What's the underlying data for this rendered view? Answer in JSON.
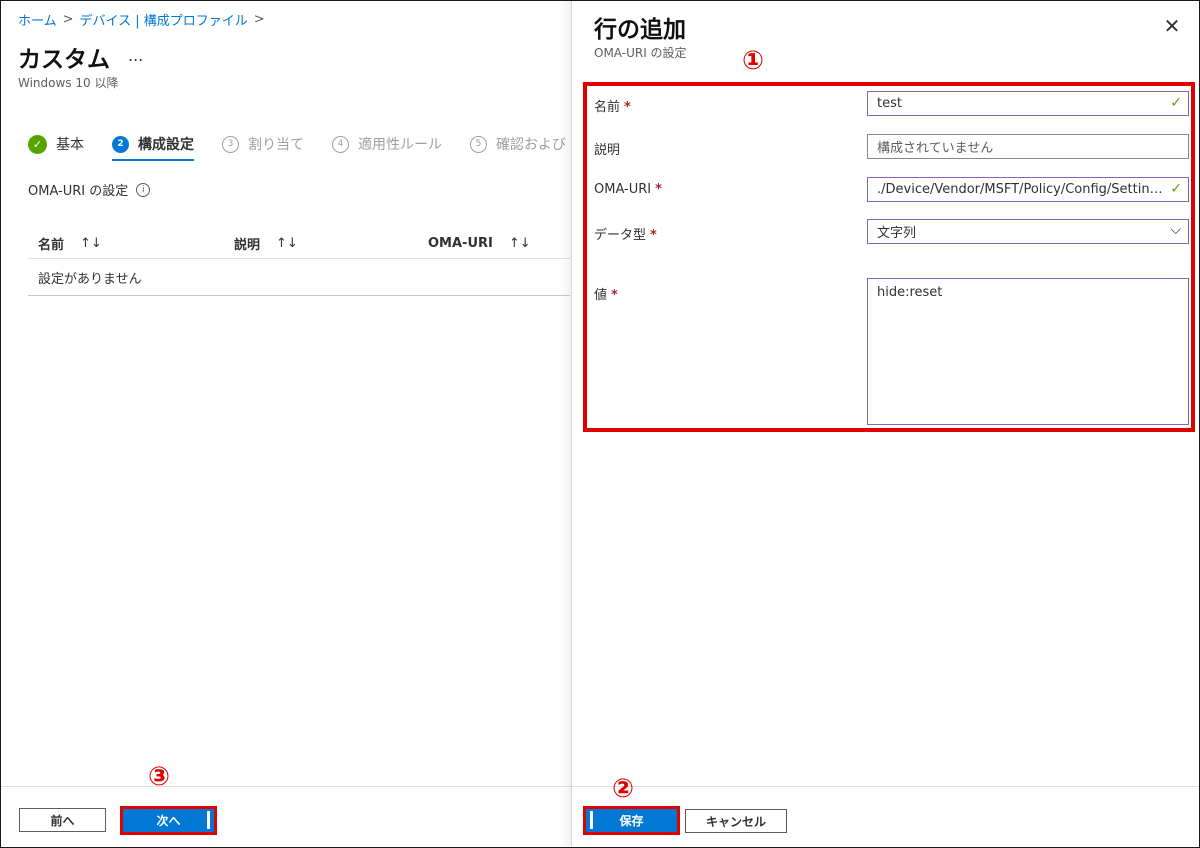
{
  "breadcrumb": {
    "home": "ホーム",
    "devices": "デバイス | 構成プロファイル",
    "sep": ">"
  },
  "page": {
    "title": "カスタム",
    "more": "...",
    "subtitle": "Windows 10 以降"
  },
  "steps": [
    {
      "num": "✓",
      "label": "基本"
    },
    {
      "num": "2",
      "label": "構成設定"
    },
    {
      "num": "3",
      "label": "割り当て"
    },
    {
      "num": "4",
      "label": "適用性ルール"
    },
    {
      "num": "5",
      "label": "確認および"
    }
  ],
  "section": {
    "label": "OMA-URI の設定",
    "info": "i"
  },
  "table": {
    "columns": [
      "名前",
      "説明",
      "OMA-URI"
    ],
    "sort_icon": "↑↓",
    "empty": "設定がありません"
  },
  "footer_left": {
    "prev": "前へ",
    "next": "次へ"
  },
  "panel": {
    "title": "行の追加",
    "subtitle": "OMA-URI の設定",
    "close": "✕",
    "fields": {
      "name_label": "名前",
      "name_value": "test",
      "desc_label": "説明",
      "desc_placeholder": "構成されていません",
      "uri_label": "OMA-URI",
      "uri_value": "./Device/Vendor/MSFT/Policy/Config/Setting...",
      "type_label": "データ型",
      "type_value": "文字列",
      "value_label": "値",
      "value_value": "hide:reset",
      "required_mark": "*",
      "check": "✓",
      "chevron": "⌵"
    },
    "save": "保存",
    "cancel": "キャンセル"
  },
  "annotations": {
    "one": "①",
    "two": "②",
    "three": "③"
  },
  "colors": {
    "accent": "#0078d4",
    "highlight": "#e00000",
    "success": "#57a300"
  }
}
